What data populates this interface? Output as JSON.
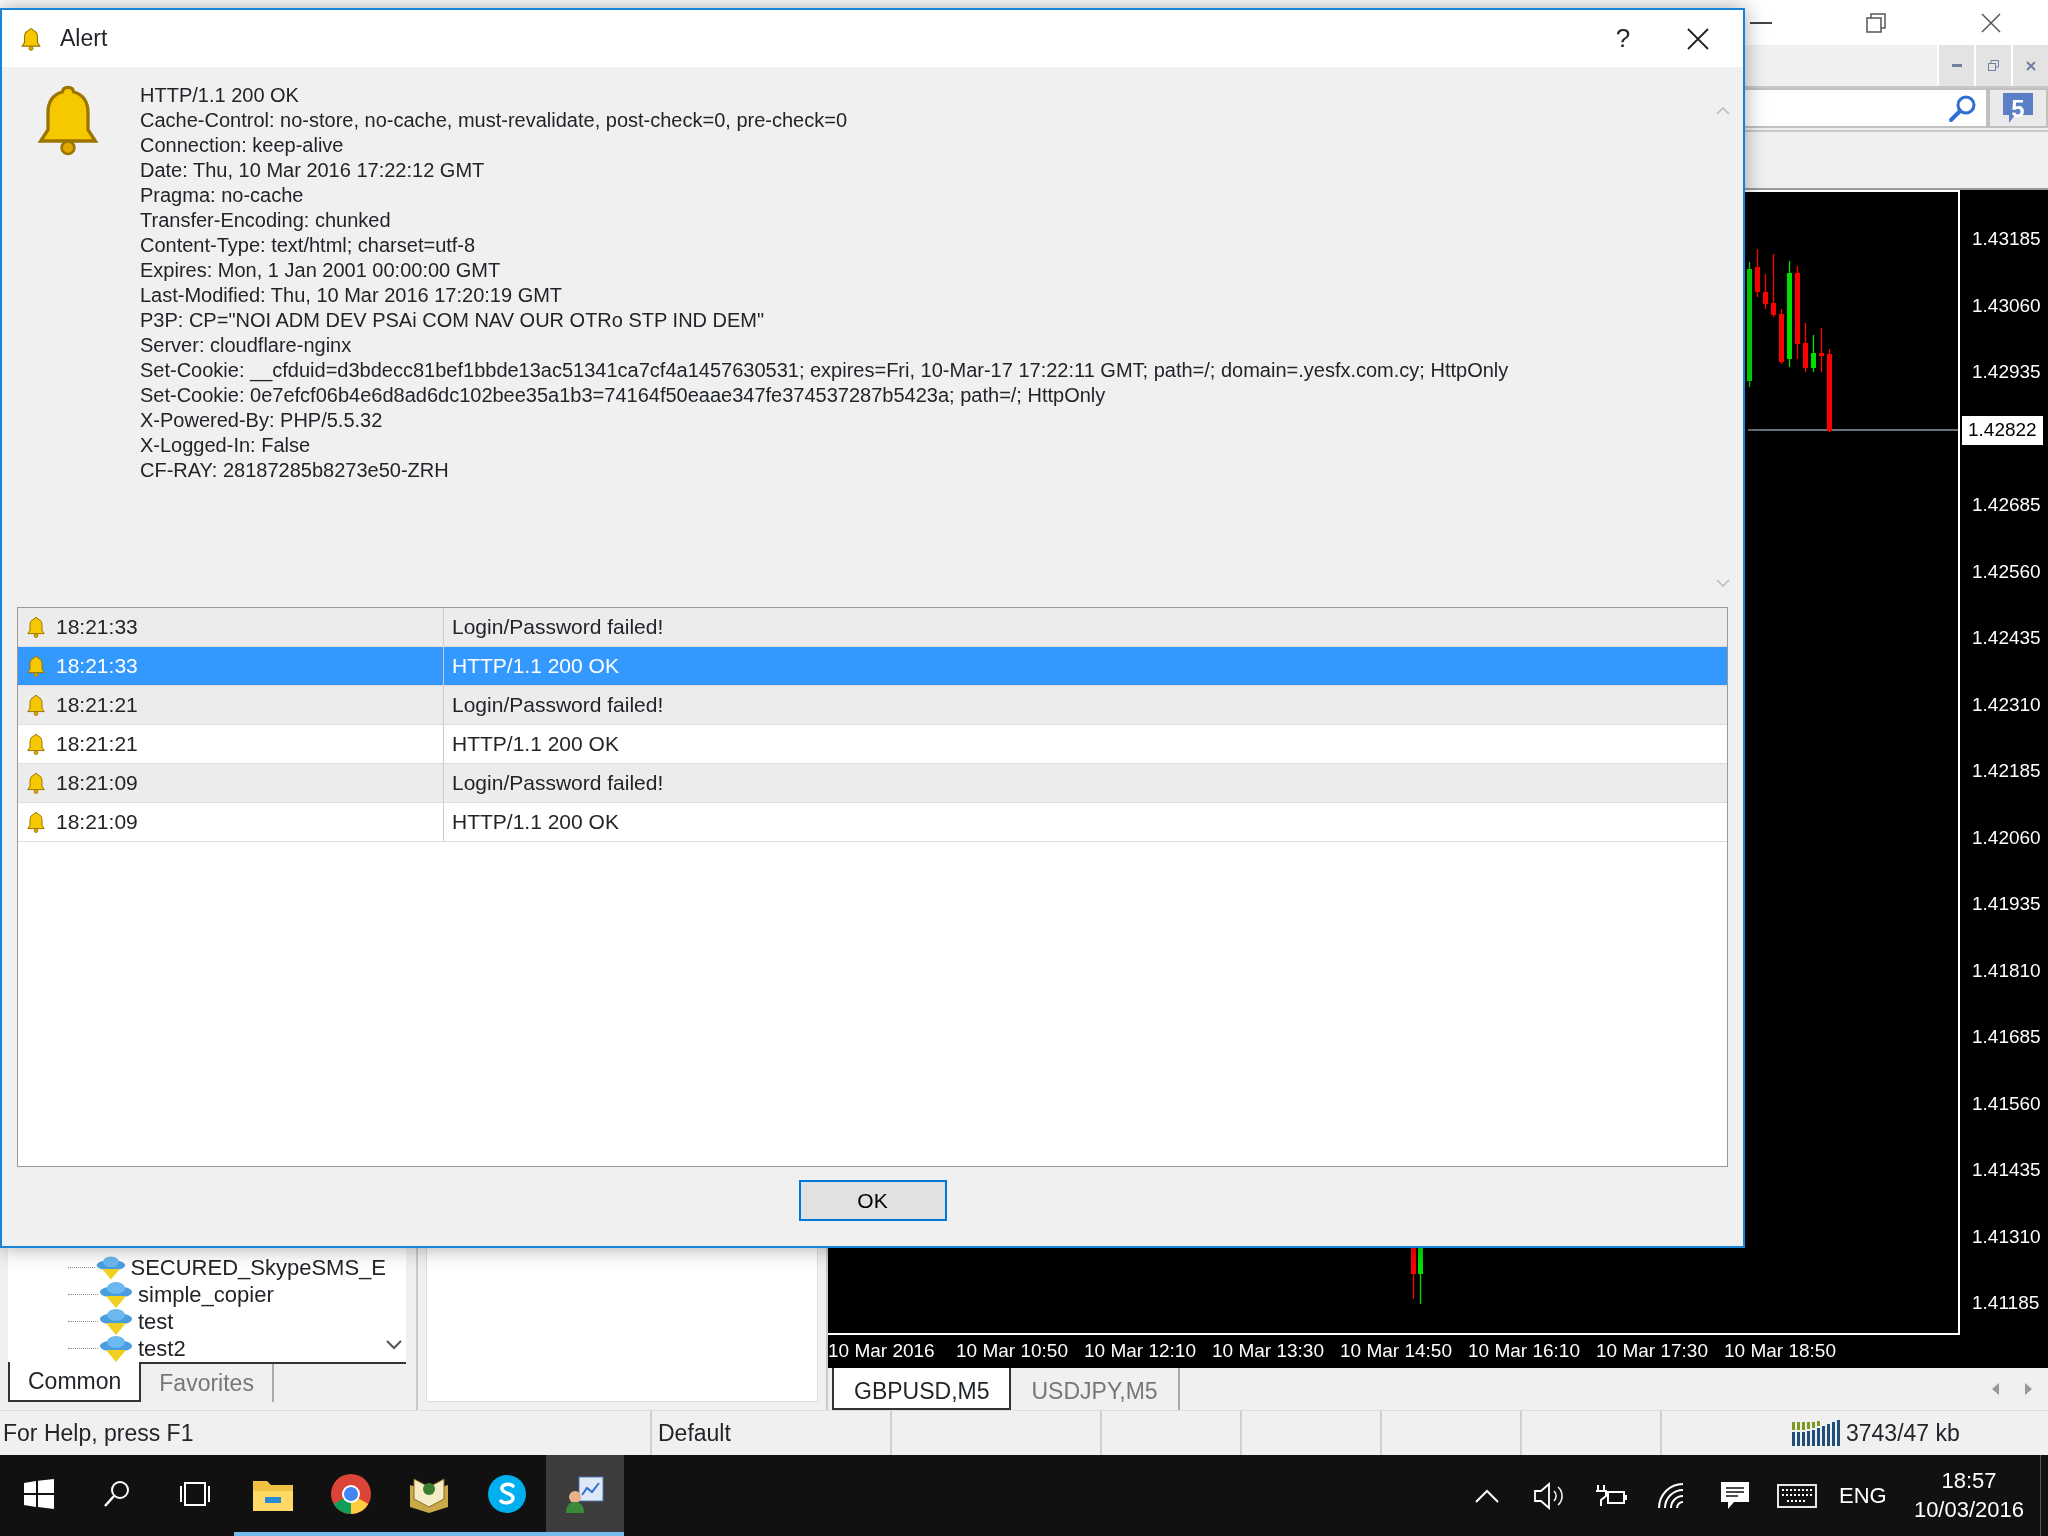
{
  "terminal": {
    "notification_count": "5"
  },
  "navigator": {
    "items": [
      {
        "label": "SECURED_SkypeSMS_E"
      },
      {
        "label": "simple_copier"
      },
      {
        "label": "test"
      },
      {
        "label": "test2"
      }
    ],
    "tabs": [
      {
        "label": "Common",
        "selected": true
      },
      {
        "label": "Favorites",
        "selected": false
      }
    ]
  },
  "chart": {
    "price_labels": [
      "1.43185",
      "1.43060",
      "1.42935",
      "1.42685",
      "1.42560",
      "1.42435",
      "1.42310",
      "1.42185",
      "1.42060",
      "1.41935",
      "1.41810",
      "1.41685",
      "1.41560",
      "1.41435",
      "1.41310",
      "1.41185"
    ],
    "current_price": "1.42822",
    "time_labels": [
      "10 Mar 2016",
      "10 Mar 10:50",
      "10 Mar 12:10",
      "10 Mar 13:30",
      "10 Mar 14:50",
      "10 Mar 16:10",
      "10 Mar 17:30",
      "10 Mar 18:50"
    ]
  },
  "chart_tabs": [
    {
      "label": "GBPUSD,M5",
      "selected": true
    },
    {
      "label": "USDJPY,M5",
      "selected": false
    }
  ],
  "status_bar": {
    "help": "For Help, press F1",
    "profile": "Default",
    "traffic": "3743/47 kb"
  },
  "dialog": {
    "title": "Alert",
    "help": "?",
    "message_lines": [
      "HTTP/1.1 200 OK",
      "Cache-Control: no-store, no-cache, must-revalidate, post-check=0, pre-check=0",
      "Connection: keep-alive",
      "Date: Thu, 10 Mar 2016 17:22:12 GMT",
      "Pragma: no-cache",
      "Transfer-Encoding: chunked",
      "Content-Type: text/html; charset=utf-8",
      "Expires: Mon, 1 Jan 2001 00:00:00 GMT",
      "Last-Modified: Thu, 10 Mar 2016 17:20:19 GMT",
      "P3P: CP=\"NOI ADM DEV PSAi COM NAV OUR OTRo STP IND DEM\"",
      "Server: cloudflare-nginx",
      "Set-Cookie: __cfduid=d3bdecc81bef1bbde13ac51341ca7cf4a1457630531; expires=Fri, 10-Mar-17 17:22:11 GMT; path=/; domain=.yesfx.com.cy; HttpOnly",
      "Set-Cookie: 0e7efcf06b4e6d8ad6dc102bee35a1b3=74164f50eaae347fe374537287b5423a; path=/; HttpOnly",
      "X-Powered-By: PHP/5.5.32",
      "X-Logged-In: False",
      "CF-RAY: 28187285b8273e50-ZRH"
    ],
    "alerts": [
      {
        "time": "18:21:33",
        "message": "Login/Password failed!",
        "selected": false
      },
      {
        "time": "18:21:33",
        "message": "HTTP/1.1 200 OK",
        "selected": true
      },
      {
        "time": "18:21:21",
        "message": "Login/Password failed!",
        "selected": false
      },
      {
        "time": "18:21:21",
        "message": "HTTP/1.1 200 OK",
        "selected": false
      },
      {
        "time": "18:21:09",
        "message": "Login/Password failed!",
        "selected": false
      },
      {
        "time": "18:21:09",
        "message": "HTTP/1.1 200 OK",
        "selected": false
      }
    ],
    "ok_button": "OK"
  },
  "taskbar": {
    "apps": [
      {
        "kind": "folder",
        "running": true,
        "selected": false
      },
      {
        "kind": "browser",
        "running": true,
        "selected": false
      },
      {
        "kind": "book",
        "running": true,
        "selected": false
      },
      {
        "kind": "chat",
        "running": true,
        "selected": false
      },
      {
        "kind": "terminal",
        "running": true,
        "selected": true
      }
    ],
    "language": "ENG",
    "time": "18:57",
    "date": "10/03/2016"
  }
}
